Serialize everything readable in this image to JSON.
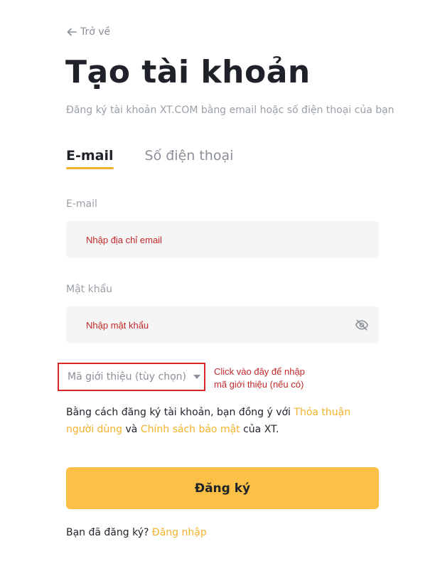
{
  "back": {
    "label": "Trở về",
    "icon": "arrow-left-icon"
  },
  "title": "Tạo tài khoản",
  "subtitle": "Đăng ký tài khoản XT.COM bằng email hoặc số điện thoại của bạn",
  "tabs": [
    {
      "label": "E-mail",
      "active": true
    },
    {
      "label": "Số điện thoại",
      "active": false
    }
  ],
  "email": {
    "label": "E-mail",
    "placeholder": "Nhập địa chỉ email",
    "value": ""
  },
  "password": {
    "label": "Mật khẩu",
    "placeholder": "Nhập mật khẩu",
    "value": "",
    "toggle_icon": "eye-off-icon"
  },
  "referral": {
    "label": "Mã giới thiệu (tùy chọn)",
    "icon": "caret-down-icon"
  },
  "annotation": {
    "line1": "Click vào đây để nhập",
    "line2": "mã giới thiệu (nếu có)"
  },
  "agreement": {
    "prefix": "Bằng cách đăng ký tài khoản, bạn đồng ý với ",
    "terms_link": "Thỏa thuận người dùng",
    "conjunction": " và ",
    "privacy_link": "Chính sách bảo mật",
    "suffix": " của XT."
  },
  "submit_label": "Đăng ký",
  "login": {
    "prompt": "Bạn đã đăng ký? ",
    "link": "Đăng nhập"
  },
  "colors": {
    "accent": "#f2b32c",
    "button": "#fcc046",
    "annotation": "#c0282a",
    "highlight_border": "#d7282a"
  }
}
